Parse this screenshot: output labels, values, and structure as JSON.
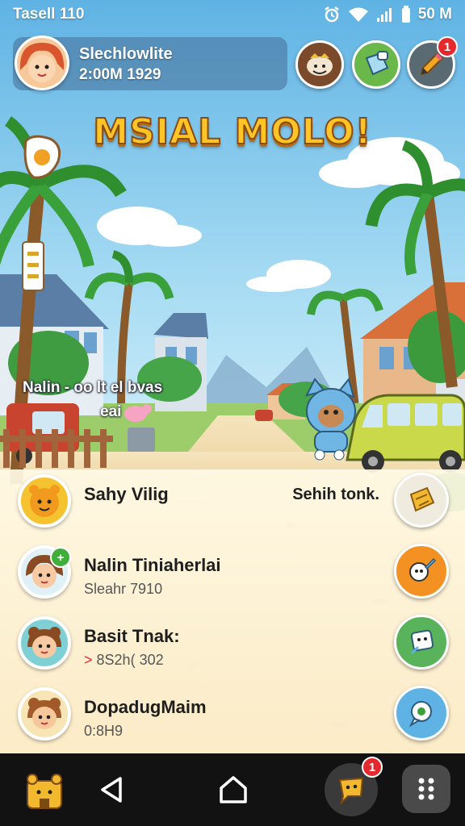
{
  "status_bar": {
    "carrier": "Tasell 110",
    "battery": "50 M"
  },
  "header": {
    "player_name": "Slechlowlite",
    "player_sub": "2:00M 1929",
    "pencil_badge": "1"
  },
  "title": "MSIAL MOLO!",
  "scene_caption": {
    "line1": "Nalin - oo lt el bvas",
    "line2": "eai"
  },
  "list": [
    {
      "title": "Sahy Vilig",
      "subtitle": "",
      "right": "Sehih tonk.",
      "marker": ""
    },
    {
      "title": "Nalin Tiniaherlai",
      "subtitle": "Sleahr 7910",
      "right": "",
      "marker": ""
    },
    {
      "title": "Basit Tnak:",
      "subtitle": "8S2h( 302",
      "right": "",
      "marker": ">"
    },
    {
      "title": "DopadugMaim",
      "subtitle": "0:8H9",
      "right": "",
      "marker": ""
    }
  ],
  "nav": {
    "chat_badge": "1"
  },
  "colors": {
    "title_fill": "#ffc526",
    "badge_red": "#e5282e",
    "nav_bg": "#121212"
  }
}
